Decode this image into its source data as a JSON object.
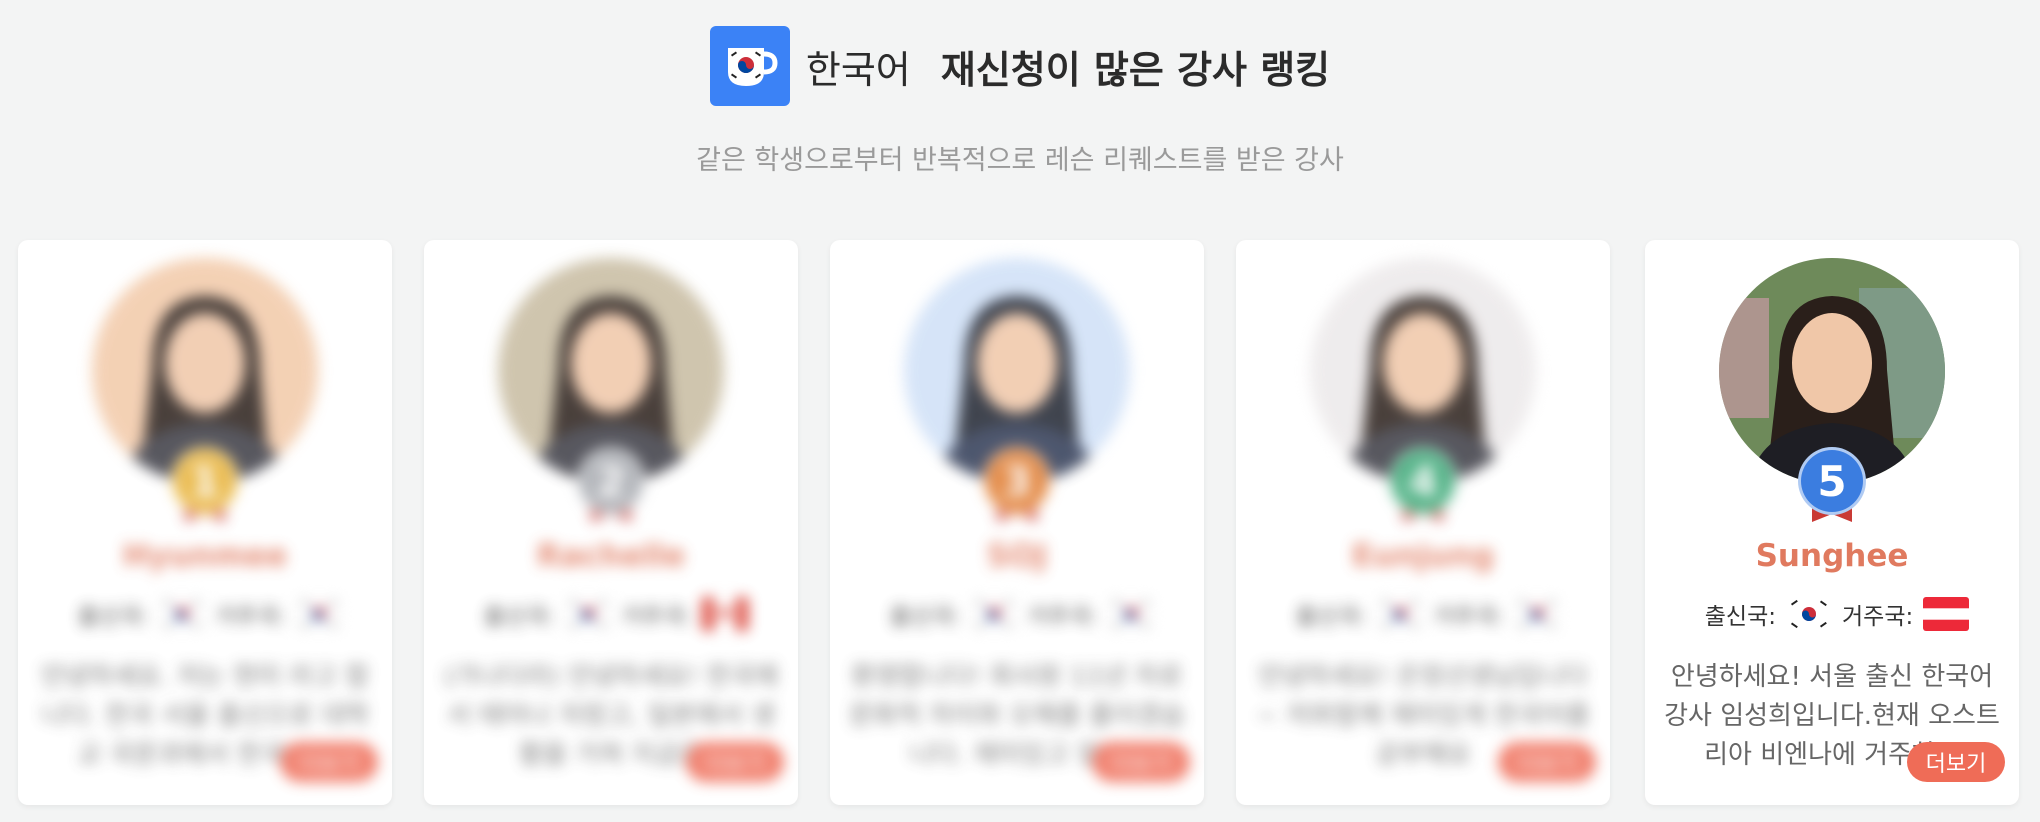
{
  "header": {
    "language": "한국어",
    "title": "재신청이 많은 강사 랭킹",
    "subtitle": "같은 학생으로부터 반복적으로 레슨 리퀘스트를 받은 강사",
    "logo_icon": "korean-flag-cup-icon",
    "logo_color": "#3b82f6"
  },
  "labels": {
    "origin": "출신국:",
    "residence": "거주국:",
    "more": "더보기"
  },
  "teachers": [
    {
      "rank": "1",
      "name": "Hyunmee",
      "origin_flag": "south-korea-flag-icon",
      "residence_flag": "south-korea-flag-icon",
      "bio": "안녕하세요. 저는 현미 라고 합니다. 한국 서울 출신으로 대학교 국문과에서 한국어를",
      "badge_color": "#e8b33a",
      "avatar_bg": "#f2c9a8"
    },
    {
      "rank": "2",
      "name": "Rachelle",
      "origin_flag": "south-korea-flag-icon",
      "residence_flag": "canada-flag-icon",
      "bio": "(가나다라) 안녕하세요! 한국에서 태어나 자랐고, 일본에서 생활을 거쳐 지금은",
      "badge_color": "#a7aab0",
      "avatar_bg": "#c7bba0"
    },
    {
      "rank": "3",
      "name": "SOJ",
      "origin_flag": "south-korea-flag-icon",
      "residence_flag": "south-korea-flag-icon",
      "bio": "환영합니다! 회사원 11년 차로 문화적 차이와 오해를 줄이겠습니다. 재미있고 알찬",
      "badge_color": "#e07b2e",
      "avatar_bg": "#cfe0f7"
    },
    {
      "rank": "4",
      "name": "Eunjung",
      "origin_flag": "south-korea-flag-icon",
      "residence_flag": "south-korea-flag-icon",
      "bio": "안녕하세요! 은정선생님입니다~ 저와함께 재미있게 한국어를 공부해요",
      "badge_color": "#3aa876",
      "avatar_bg": "#ece9ea"
    },
    {
      "rank": "5",
      "name": "Sunghee",
      "origin_flag": "south-korea-flag-icon",
      "residence_flag": "austria-flag-icon",
      "bio": "안녕하세요! 서울 출신 한국어 강사 임성희입니다.현재 오스트리아 비엔나에 거주하고",
      "badge_color": "#3b7de0",
      "avatar_bg": "#6e8a5a"
    }
  ],
  "colors": {
    "name": "#e07a5f",
    "more_button": "#ef6c57",
    "background": "#f3f4f4"
  }
}
